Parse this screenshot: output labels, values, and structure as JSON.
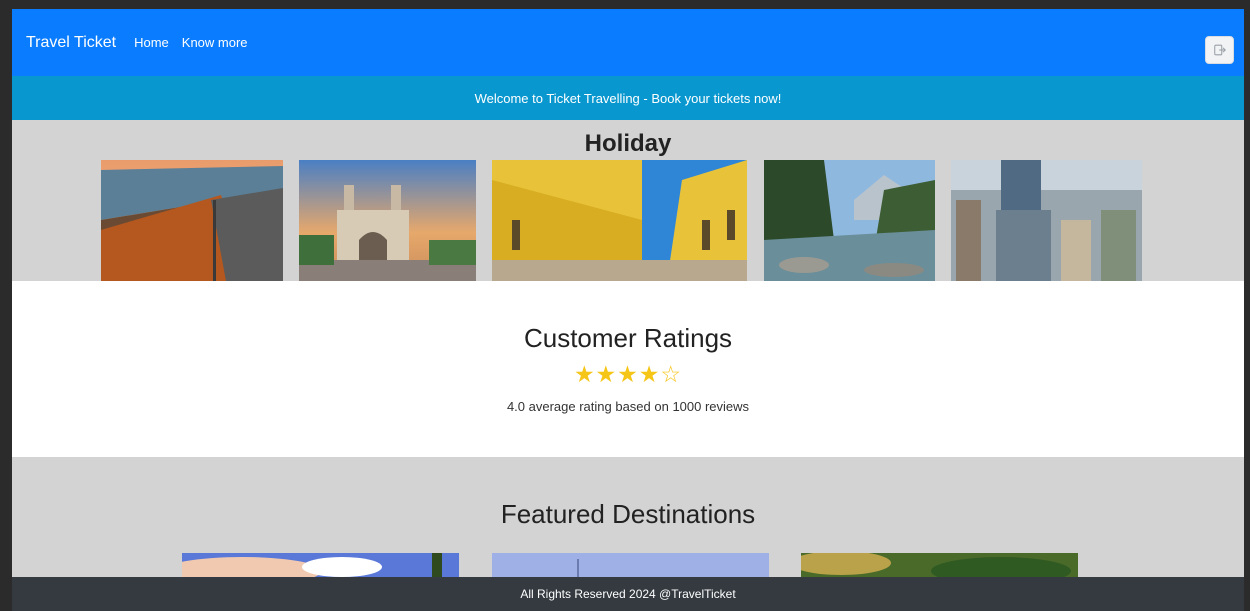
{
  "navbar": {
    "brand": "Travel Ticket",
    "links": [
      "Home",
      "Know more"
    ],
    "logout_icon": "logout-icon",
    "color": "#0a7cff"
  },
  "banner": {
    "text": "Welcome to Ticket Travelling - Book your tickets now!",
    "color": "#0897cf"
  },
  "holiday": {
    "title": "Holiday"
  },
  "ratings": {
    "title": "Customer Ratings",
    "stars": "★★★★☆",
    "rating": 4,
    "max_rating": 5,
    "summary": "4.0 average rating based on 1000 reviews",
    "star_color": "#f5c518"
  },
  "featured": {
    "title": "Featured Destinations"
  },
  "footer": {
    "text": "All Rights Reserved 2024 @TravelTicket",
    "color": "#343a40"
  }
}
